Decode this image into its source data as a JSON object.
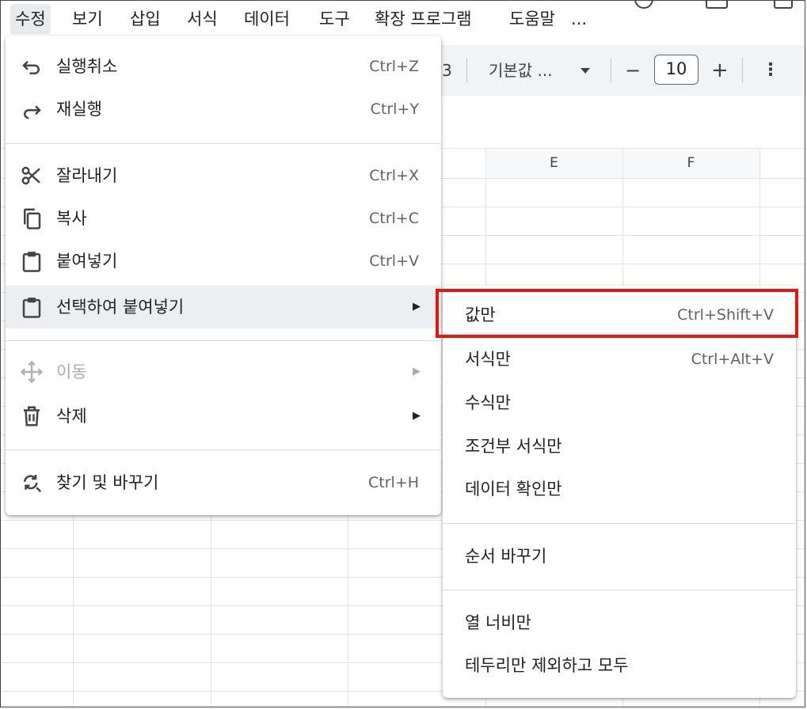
{
  "menubar": {
    "items": [
      "수정",
      "보기",
      "삽입",
      "서식",
      "데이터",
      "도구",
      "확장 프로그램",
      "도움말",
      "..."
    ]
  },
  "toolbar": {
    "partial_text": "3",
    "font_name": "기본값 ...",
    "minus": "−",
    "font_size": "10",
    "plus": "+",
    "more": "⋮"
  },
  "grid": {
    "columns": [
      "E",
      "F"
    ]
  },
  "edit_menu": {
    "items": [
      {
        "label": "실행취소",
        "shortcut": "Ctrl+Z",
        "icon": "undo-icon"
      },
      {
        "label": "재실행",
        "shortcut": "Ctrl+Y",
        "icon": "redo-icon"
      },
      {
        "label": "잘라내기",
        "shortcut": "Ctrl+X",
        "icon": "scissors-icon"
      },
      {
        "label": "복사",
        "shortcut": "Ctrl+C",
        "icon": "copy-icon"
      },
      {
        "label": "붙여넣기",
        "shortcut": "Ctrl+V",
        "icon": "clipboard-icon"
      },
      {
        "label": "선택하여 붙여넣기",
        "arrow": "▶",
        "icon": "clipboard-icon"
      },
      {
        "label": "이동",
        "arrow": "▶",
        "icon": "move-icon",
        "disabled": true
      },
      {
        "label": "삭제",
        "arrow": "▶",
        "icon": "trash-icon"
      },
      {
        "label": "찾기 및 바꾸기",
        "shortcut": "Ctrl+H",
        "icon": "find-replace-icon"
      }
    ]
  },
  "paste_menu": {
    "items": [
      {
        "label": "값만",
        "shortcut": "Ctrl+Shift+V"
      },
      {
        "label": "서식만",
        "shortcut": "Ctrl+Alt+V"
      },
      {
        "label": "수식만"
      },
      {
        "label": "조건부 서식만"
      },
      {
        "label": "데이터 확인만"
      },
      {
        "label": "순서 바꾸기"
      },
      {
        "label": "열 너비만"
      },
      {
        "label": "테두리만 제외하고 모두"
      }
    ]
  },
  "colors": {
    "highlight": "#e6150f",
    "hover": "#eceff1",
    "toolbar_bg": "#f1f3f4"
  }
}
